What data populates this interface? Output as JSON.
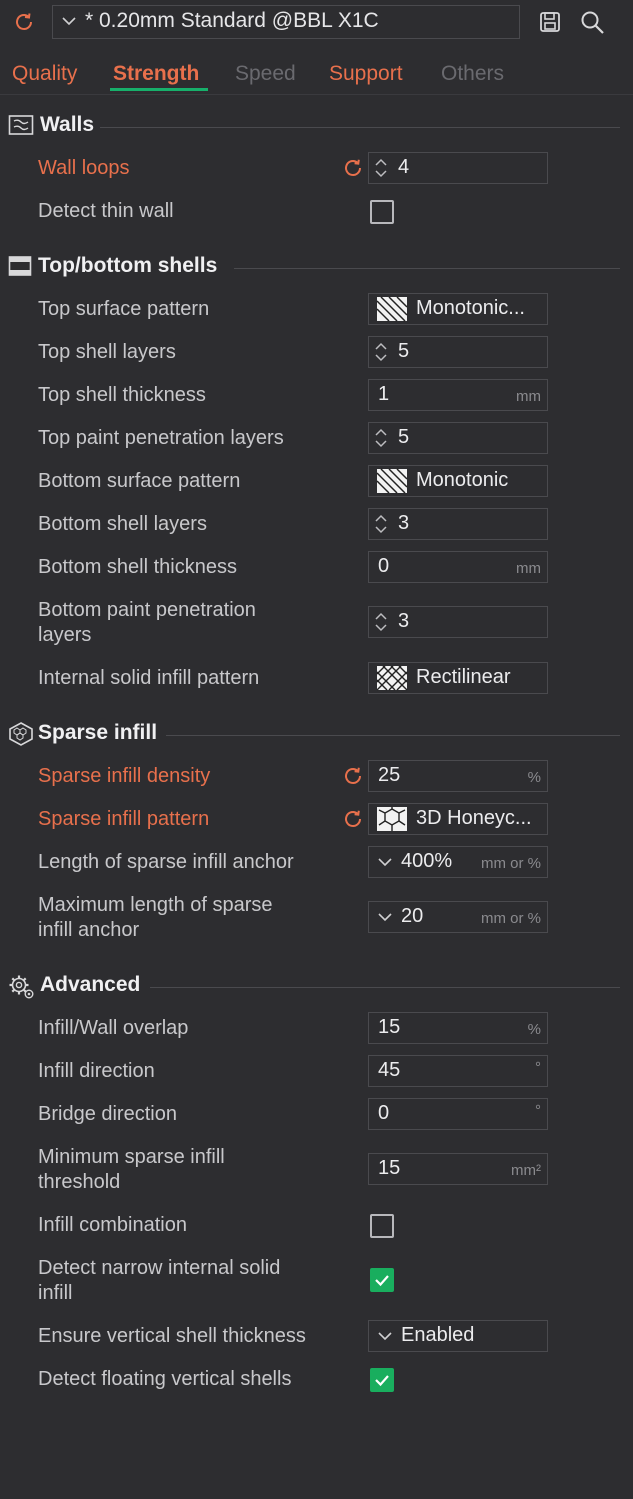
{
  "preset": {
    "name": "* 0.20mm Standard @BBL X1C"
  },
  "tabs": [
    {
      "label": "Quality",
      "state": "modified"
    },
    {
      "label": "Strength",
      "state": "active"
    },
    {
      "label": "Speed",
      "state": "default"
    },
    {
      "label": "Support",
      "state": "modified"
    },
    {
      "label": "Others",
      "state": "default"
    }
  ],
  "colors": {
    "accent": "#e8704c",
    "checked": "#19ae5e",
    "active_tab_underline": "#17b06b",
    "background": "#2d2d30"
  },
  "sections": {
    "walls": {
      "title": "Walls",
      "icon": "walls-icon"
    },
    "shells": {
      "title": "Top/bottom shells",
      "icon": "shells-icon"
    },
    "sparse": {
      "title": "Sparse infill",
      "icon": "honeycomb-icon"
    },
    "advanced": {
      "title": "Advanced",
      "icon": "gears-icon"
    }
  },
  "walls": {
    "wall_loops": {
      "label": "Wall loops",
      "value": "4"
    },
    "detect_thin_wall": {
      "label": "Detect thin wall",
      "checked": false
    }
  },
  "shells": {
    "top_surface_pattern": {
      "label": "Top surface pattern",
      "value": "Monotonic..."
    },
    "top_shell_layers": {
      "label": "Top shell layers",
      "value": "5"
    },
    "top_shell_thickness": {
      "label": "Top shell thickness",
      "value": "1",
      "unit": "mm"
    },
    "top_paint_penetration": {
      "label": "Top paint penetration layers",
      "value": "5"
    },
    "bottom_surface_pattern": {
      "label": "Bottom surface pattern",
      "value": "Monotonic"
    },
    "bottom_shell_layers": {
      "label": "Bottom shell layers",
      "value": "3"
    },
    "bottom_shell_thickness": {
      "label": "Bottom shell thickness",
      "value": "0",
      "unit": "mm"
    },
    "bottom_paint_penetration": {
      "label_1": "Bottom paint penetration",
      "label_2": "layers",
      "value": "3"
    },
    "internal_solid_infill": {
      "label": "Internal solid infill pattern",
      "value": "Rectilinear"
    }
  },
  "sparse": {
    "density": {
      "label": "Sparse infill density",
      "value": "25",
      "unit": "%"
    },
    "pattern": {
      "label": "Sparse infill pattern",
      "value": "3D Honeyc..."
    },
    "anchor_len": {
      "label": "Length of sparse infill anchor",
      "value": "400%",
      "unit": "mm or %"
    },
    "anchor_max": {
      "label_1": "Maximum length of sparse",
      "label_2": "infill anchor",
      "value": "20",
      "unit": "mm or %"
    }
  },
  "advanced": {
    "overlap": {
      "label": "Infill/Wall overlap",
      "value": "15",
      "unit": "%"
    },
    "infill_direction": {
      "label": "Infill direction",
      "value": "45",
      "unit": "°"
    },
    "bridge_direction": {
      "label": "Bridge direction",
      "value": "0",
      "unit": "°"
    },
    "min_sparse": {
      "label_1": "Minimum sparse infill",
      "label_2": "threshold",
      "value": "15",
      "unit": "mm²"
    },
    "infill_combination": {
      "label": "Infill combination",
      "checked": false
    },
    "detect_narrow": {
      "label_1": "Detect narrow internal solid",
      "label_2": "infill",
      "checked": true
    },
    "ensure_vertical": {
      "label": "Ensure vertical shell thickness",
      "value": "Enabled"
    },
    "detect_floating": {
      "label": "Detect floating vertical shells",
      "checked": true
    }
  }
}
